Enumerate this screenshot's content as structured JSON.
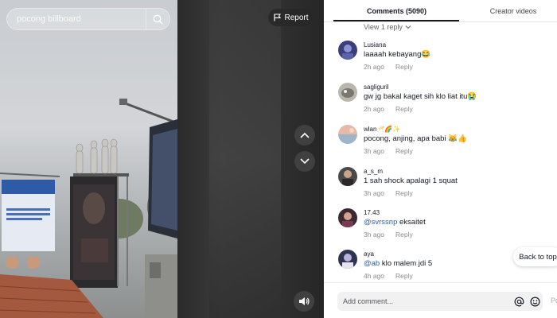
{
  "video": {
    "search_placeholder": "pocong billboard",
    "report_label": "Report"
  },
  "tabs": {
    "comments": "Comments (5090)",
    "creator_videos": "Creator videos"
  },
  "view_reply": "View 1 reply",
  "comments": [
    {
      "user": "Lusiana",
      "text": "laaaah kebayang😂",
      "time": "2h ago",
      "reply": "Reply"
    },
    {
      "user": "sagliguril",
      "text": "gw jg bakal kaget sih klo liat itu😭",
      "time": "2h ago",
      "reply": "Reply"
    },
    {
      "user": "wlan🥂🌈✨",
      "text": "pocong, anjing, apa babi 😹👍",
      "time": "3h ago",
      "reply": "Reply"
    },
    {
      "user": "a_s_m",
      "text": "1 sah shock apalagi 1 squat",
      "time": "3h ago",
      "reply": "Reply"
    },
    {
      "user": "17.43",
      "mention": "@svrssnp",
      "text": " eksaitet",
      "time": "3h ago",
      "reply": "Reply"
    },
    {
      "user": "aya",
      "mention": "@ab",
      "text": " klo malem jdi 5",
      "time": "4h ago",
      "reply": "Reply"
    }
  ],
  "back_to_top": "Back to top",
  "composer": {
    "placeholder": "Add comment...",
    "post_label": "Post"
  },
  "colors": {
    "mention": "#2b5db3",
    "muted": "#8a8b91"
  }
}
